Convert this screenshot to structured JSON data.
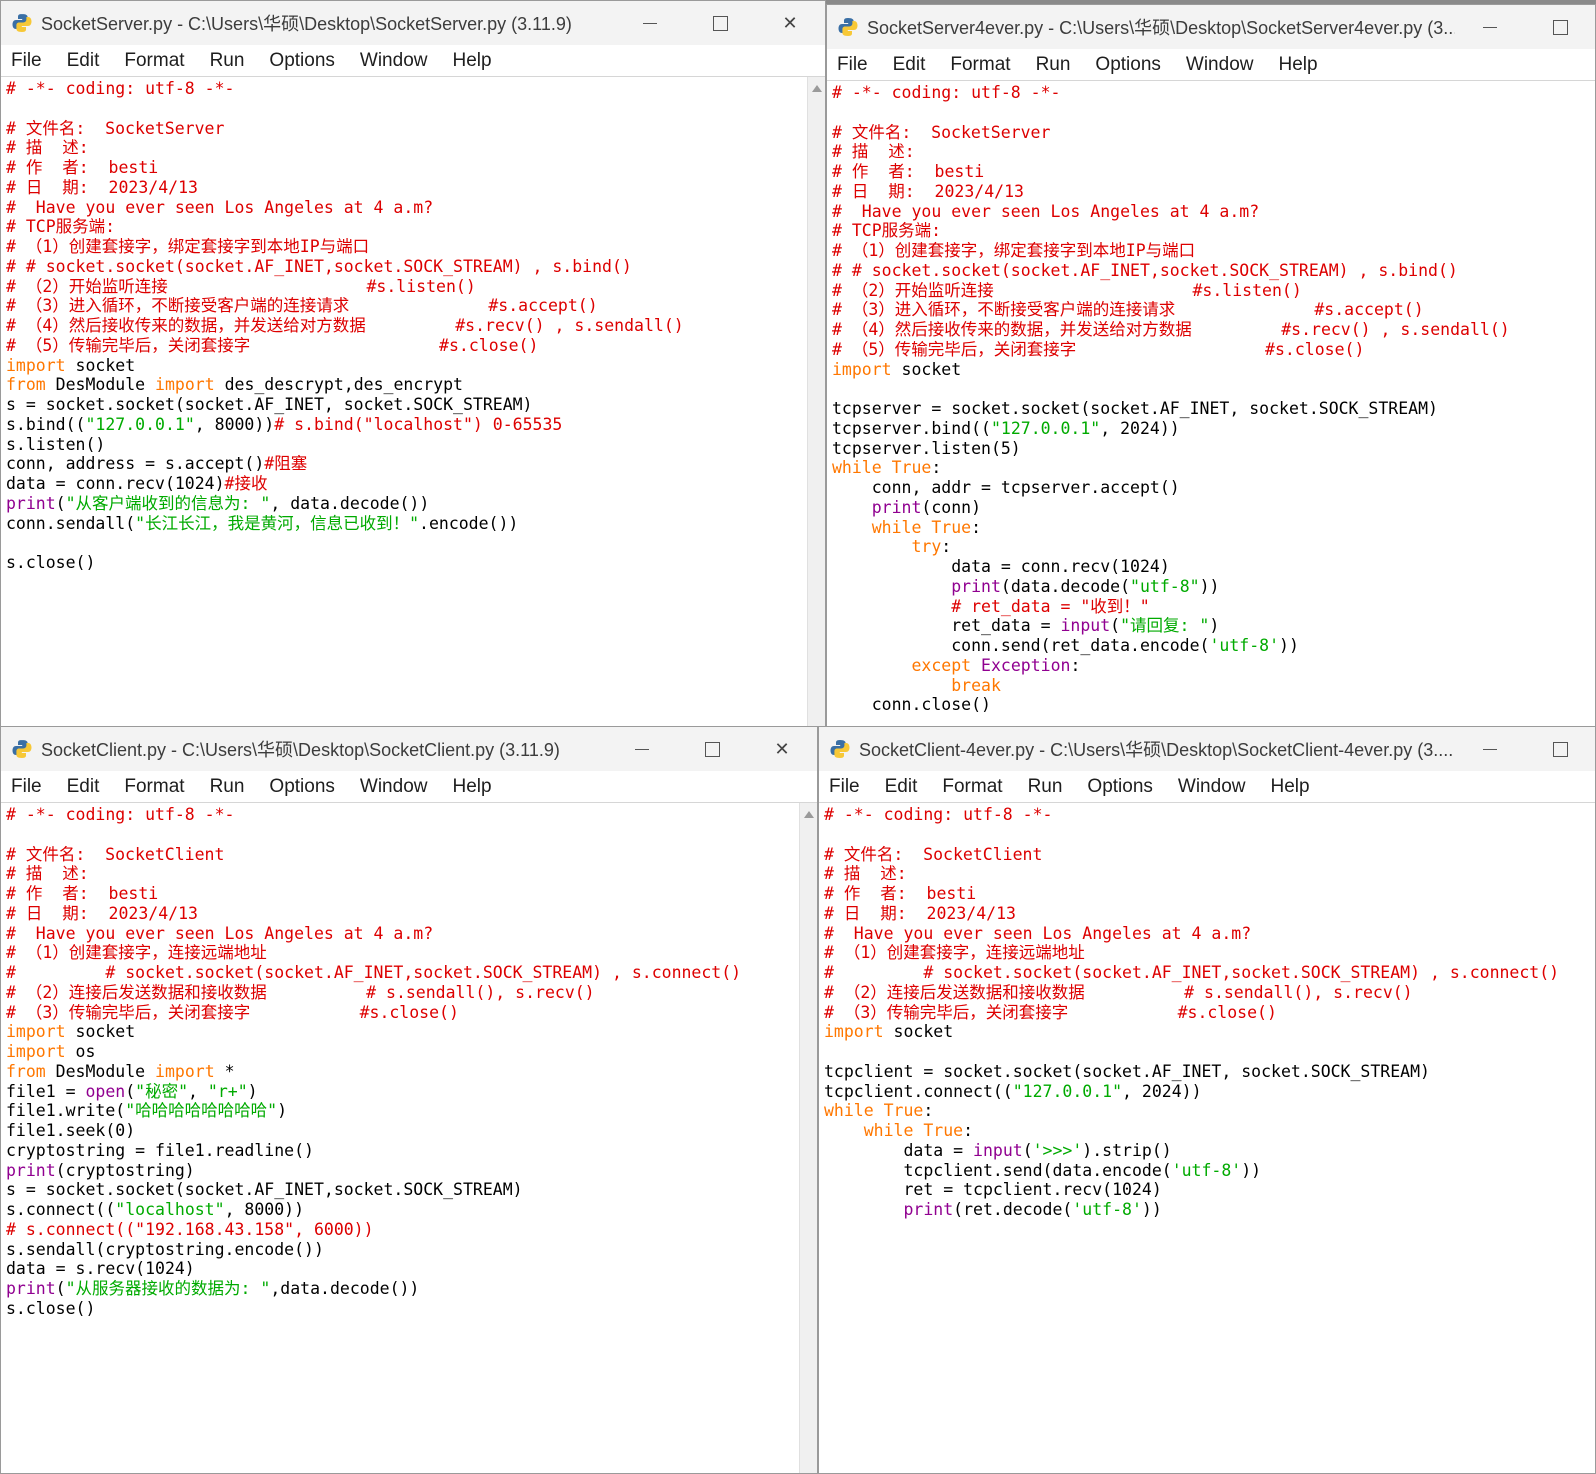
{
  "menu": [
    "File",
    "Edit",
    "Format",
    "Run",
    "Options",
    "Window",
    "Help"
  ],
  "windows": [
    {
      "id": "w1",
      "title": "SocketServer.py - C:\\Users\\华硕\\Desktop\\SocketServer.py (3.11.9)",
      "lines": [
        [
          [
            "c",
            "# -*- coding: utf-8 -*-"
          ]
        ],
        [],
        [
          [
            "c",
            "# 文件名:  SocketServer"
          ]
        ],
        [
          [
            "c",
            "# 描  述:"
          ]
        ],
        [
          [
            "c",
            "# 作  者:  besti"
          ]
        ],
        [
          [
            "c",
            "# 日  期:  2023/4/13"
          ]
        ],
        [
          [
            "c",
            "#  Have you ever seen Los Angeles at 4 a.m?"
          ]
        ],
        [
          [
            "c",
            "# TCP服务端:"
          ]
        ],
        [
          [
            "c",
            "# （1）创建套接字，绑定套接字到本地IP与端口"
          ]
        ],
        [
          [
            "c",
            "# # socket.socket(socket.AF_INET,socket.SOCK_STREAM) , s.bind()"
          ]
        ],
        [
          [
            "c",
            "# （2）开始监听连接                    #s.listen()"
          ]
        ],
        [
          [
            "c",
            "# （3）进入循环，不断接受客户端的连接请求              #s.accept()"
          ]
        ],
        [
          [
            "c",
            "# （4）然后接收传来的数据，并发送给对方数据         #s.recv() , s.sendall()"
          ]
        ],
        [
          [
            "c",
            "# （5）传输完毕后，关闭套接字                   #s.close()"
          ]
        ],
        [
          [
            "k",
            "import"
          ],
          [
            "t",
            " socket"
          ]
        ],
        [
          [
            "k",
            "from"
          ],
          [
            "t",
            " DesModule "
          ],
          [
            "k",
            "import"
          ],
          [
            "t",
            " des_descrypt,des_encrypt"
          ]
        ],
        [
          [
            "t",
            "s = socket.socket(socket.AF_INET, socket.SOCK_STREAM)"
          ]
        ],
        [
          [
            "t",
            "s.bind(("
          ],
          [
            "s",
            "\"127.0.0.1\""
          ],
          [
            "t",
            ", 8000))"
          ],
          [
            "c",
            "# s.bind(\"localhost\") 0-65535"
          ]
        ],
        [
          [
            "t",
            "s.listen()"
          ]
        ],
        [
          [
            "t",
            "conn, address = s.accept()"
          ],
          [
            "c",
            "#阻塞"
          ]
        ],
        [
          [
            "t",
            "data = conn.recv(1024)"
          ],
          [
            "c",
            "#接收"
          ]
        ],
        [
          [
            "b",
            "print"
          ],
          [
            "t",
            "("
          ],
          [
            "s",
            "\"从客户端收到的信息为: \""
          ],
          [
            "t",
            ", data.decode())"
          ]
        ],
        [
          [
            "t",
            "conn.sendall("
          ],
          [
            "s",
            "\"长江长江，我是黄河，信息已收到！\""
          ],
          [
            "t",
            ".encode())"
          ]
        ],
        [],
        [
          [
            "t",
            "s.close()"
          ]
        ]
      ]
    },
    {
      "id": "w2",
      "title": "SocketServer4ever.py - C:\\Users\\华硕\\Desktop\\SocketServer4ever.py (3....",
      "lines": [
        [
          [
            "c",
            "# -*- coding: utf-8 -*-"
          ]
        ],
        [],
        [
          [
            "c",
            "# 文件名:  SocketServer"
          ]
        ],
        [
          [
            "c",
            "# 描  述:"
          ]
        ],
        [
          [
            "c",
            "# 作  者:  besti"
          ]
        ],
        [
          [
            "c",
            "# 日  期:  2023/4/13"
          ]
        ],
        [
          [
            "c",
            "#  Have you ever seen Los Angeles at 4 a.m?"
          ]
        ],
        [
          [
            "c",
            "# TCP服务端:"
          ]
        ],
        [
          [
            "c",
            "# （1）创建套接字，绑定套接字到本地IP与端口"
          ]
        ],
        [
          [
            "c",
            "# # socket.socket(socket.AF_INET,socket.SOCK_STREAM) , s.bind()"
          ]
        ],
        [
          [
            "c",
            "# （2）开始监听连接                    #s.listen()"
          ]
        ],
        [
          [
            "c",
            "# （3）进入循环，不断接受客户端的连接请求              #s.accept()"
          ]
        ],
        [
          [
            "c",
            "# （4）然后接收传来的数据，并发送给对方数据         #s.recv() , s.sendall()"
          ]
        ],
        [
          [
            "c",
            "# （5）传输完毕后，关闭套接字                   #s.close()"
          ]
        ],
        [
          [
            "k",
            "import"
          ],
          [
            "t",
            " socket"
          ]
        ],
        [],
        [
          [
            "t",
            "tcpserver = socket.socket(socket.AF_INET, socket.SOCK_STREAM)"
          ]
        ],
        [
          [
            "t",
            "tcpserver.bind(("
          ],
          [
            "s",
            "\"127.0.0.1\""
          ],
          [
            "t",
            ", 2024))"
          ]
        ],
        [
          [
            "t",
            "tcpserver.listen(5)"
          ]
        ],
        [
          [
            "k",
            "while"
          ],
          [
            "t",
            " "
          ],
          [
            "k",
            "True"
          ],
          [
            "t",
            ":"
          ]
        ],
        [
          [
            "t",
            "    conn, addr = tcpserver.accept()"
          ]
        ],
        [
          [
            "t",
            "    "
          ],
          [
            "b",
            "print"
          ],
          [
            "t",
            "(conn)"
          ]
        ],
        [
          [
            "t",
            "    "
          ],
          [
            "k",
            "while"
          ],
          [
            "t",
            " "
          ],
          [
            "k",
            "True"
          ],
          [
            "t",
            ":"
          ]
        ],
        [
          [
            "t",
            "        "
          ],
          [
            "k",
            "try"
          ],
          [
            "t",
            ":"
          ]
        ],
        [
          [
            "t",
            "            data = conn.recv(1024)"
          ]
        ],
        [
          [
            "t",
            "            "
          ],
          [
            "b",
            "print"
          ],
          [
            "t",
            "(data.decode("
          ],
          [
            "s",
            "\"utf-8\""
          ],
          [
            "t",
            "))"
          ]
        ],
        [
          [
            "t",
            "            "
          ],
          [
            "c",
            "# ret_data = \"收到！\""
          ]
        ],
        [
          [
            "t",
            "            ret_data = "
          ],
          [
            "b",
            "input"
          ],
          [
            "t",
            "("
          ],
          [
            "s",
            "\"请回复: \""
          ],
          [
            "t",
            ")"
          ]
        ],
        [
          [
            "t",
            "            conn.send(ret_data.encode("
          ],
          [
            "s",
            "'utf-8'"
          ],
          [
            "t",
            "))"
          ]
        ],
        [
          [
            "t",
            "        "
          ],
          [
            "k",
            "except"
          ],
          [
            "t",
            " "
          ],
          [
            "b",
            "Exception"
          ],
          [
            "t",
            ":"
          ]
        ],
        [
          [
            "t",
            "            "
          ],
          [
            "k",
            "break"
          ]
        ],
        [
          [
            "t",
            "    conn.close()"
          ]
        ]
      ]
    },
    {
      "id": "w3",
      "title": "SocketClient.py - C:\\Users\\华硕\\Desktop\\SocketClient.py (3.11.9)",
      "lines": [
        [
          [
            "c",
            "# -*- coding: utf-8 -*-"
          ]
        ],
        [],
        [
          [
            "c",
            "# 文件名:  SocketClient"
          ]
        ],
        [
          [
            "c",
            "# 描  述:"
          ]
        ],
        [
          [
            "c",
            "# 作  者:  besti"
          ]
        ],
        [
          [
            "c",
            "# 日  期:  2023/4/13"
          ]
        ],
        [
          [
            "c",
            "#  Have you ever seen Los Angeles at 4 a.m?"
          ]
        ],
        [
          [
            "c",
            "# （1）创建套接字，连接远端地址"
          ]
        ],
        [
          [
            "c",
            "#         # socket.socket(socket.AF_INET,socket.SOCK_STREAM) , s.connect()"
          ]
        ],
        [
          [
            "c",
            "# （2）连接后发送数据和接收数据          # s.sendall(), s.recv()"
          ]
        ],
        [
          [
            "c",
            "# （3）传输完毕后，关闭套接字           #s.close()"
          ]
        ],
        [
          [
            "k",
            "import"
          ],
          [
            "t",
            " socket"
          ]
        ],
        [
          [
            "k",
            "import"
          ],
          [
            "t",
            " os"
          ]
        ],
        [
          [
            "k",
            "from"
          ],
          [
            "t",
            " DesModule "
          ],
          [
            "k",
            "import"
          ],
          [
            "t",
            " *"
          ]
        ],
        [
          [
            "t",
            "file1 = "
          ],
          [
            "b",
            "open"
          ],
          [
            "t",
            "("
          ],
          [
            "s",
            "\"秘密\""
          ],
          [
            "t",
            ", "
          ],
          [
            "s",
            "\"r+\""
          ],
          [
            "t",
            ")"
          ]
        ],
        [
          [
            "t",
            "file1.write("
          ],
          [
            "s",
            "\"哈哈哈哈哈哈哈哈\""
          ],
          [
            "t",
            ")"
          ]
        ],
        [
          [
            "t",
            "file1.seek(0)"
          ]
        ],
        [
          [
            "t",
            "cryptostring = file1.readline()"
          ]
        ],
        [
          [
            "b",
            "print"
          ],
          [
            "t",
            "(cryptostring)"
          ]
        ],
        [
          [
            "t",
            "s = socket.socket(socket.AF_INET,socket.SOCK_STREAM)"
          ]
        ],
        [
          [
            "t",
            "s.connect(("
          ],
          [
            "s",
            "\"localhost\""
          ],
          [
            "t",
            ", 8000))"
          ]
        ],
        [
          [
            "c",
            "# s.connect((\"192.168.43.158\", 6000))"
          ]
        ],
        [
          [
            "t",
            "s.sendall(cryptostring.encode())"
          ]
        ],
        [
          [
            "t",
            "data = s.recv(1024)"
          ]
        ],
        [
          [
            "b",
            "print"
          ],
          [
            "t",
            "("
          ],
          [
            "s",
            "\"从服务器接收的数据为: \""
          ],
          [
            "t",
            ",data.decode())"
          ]
        ],
        [
          [
            "t",
            "s.close()"
          ]
        ]
      ]
    },
    {
      "id": "w4",
      "title": "SocketClient-4ever.py - C:\\Users\\华硕\\Desktop\\SocketClient-4ever.py (3....",
      "lines": [
        [
          [
            "c",
            "# -*- coding: utf-8 -*-"
          ]
        ],
        [],
        [
          [
            "c",
            "# 文件名:  SocketClient"
          ]
        ],
        [
          [
            "c",
            "# 描  述:"
          ]
        ],
        [
          [
            "c",
            "# 作  者:  besti"
          ]
        ],
        [
          [
            "c",
            "# 日  期:  2023/4/13"
          ]
        ],
        [
          [
            "c",
            "#  Have you ever seen Los Angeles at 4 a.m?"
          ]
        ],
        [
          [
            "c",
            "# （1）创建套接字，连接远端地址"
          ]
        ],
        [
          [
            "c",
            "#         # socket.socket(socket.AF_INET,socket.SOCK_STREAM) , s.connect()"
          ]
        ],
        [
          [
            "c",
            "# （2）连接后发送数据和接收数据          # s.sendall(), s.recv()"
          ]
        ],
        [
          [
            "c",
            "# （3）传输完毕后，关闭套接字           #s.close()"
          ]
        ],
        [
          [
            "k",
            "import"
          ],
          [
            "t",
            " socket"
          ]
        ],
        [],
        [
          [
            "t",
            "tcpclient = socket.socket(socket.AF_INET, socket.SOCK_STREAM)"
          ]
        ],
        [
          [
            "t",
            "tcpclient.connect(("
          ],
          [
            "s",
            "\"127.0.0.1\""
          ],
          [
            "t",
            ", 2024))"
          ]
        ],
        [
          [
            "k",
            "while"
          ],
          [
            "t",
            " "
          ],
          [
            "k",
            "True"
          ],
          [
            "t",
            ":"
          ]
        ],
        [
          [
            "t",
            "    "
          ],
          [
            "k",
            "while"
          ],
          [
            "t",
            " "
          ],
          [
            "k",
            "True"
          ],
          [
            "t",
            ":"
          ]
        ],
        [
          [
            "t",
            "        data = "
          ],
          [
            "b",
            "input"
          ],
          [
            "t",
            "("
          ],
          [
            "s",
            "'>>>'"
          ],
          [
            "t",
            ").strip()"
          ]
        ],
        [
          [
            "t",
            "        tcpclient.send(data.encode("
          ],
          [
            "s",
            "'utf-8'"
          ],
          [
            "t",
            "))"
          ]
        ],
        [
          [
            "t",
            "        ret = tcpclient.recv(1024)"
          ]
        ],
        [
          [
            "t",
            "        "
          ],
          [
            "b",
            "print"
          ],
          [
            "t",
            "(ret.decode("
          ],
          [
            "s",
            "'utf-8'"
          ],
          [
            "t",
            "))"
          ]
        ]
      ]
    }
  ]
}
